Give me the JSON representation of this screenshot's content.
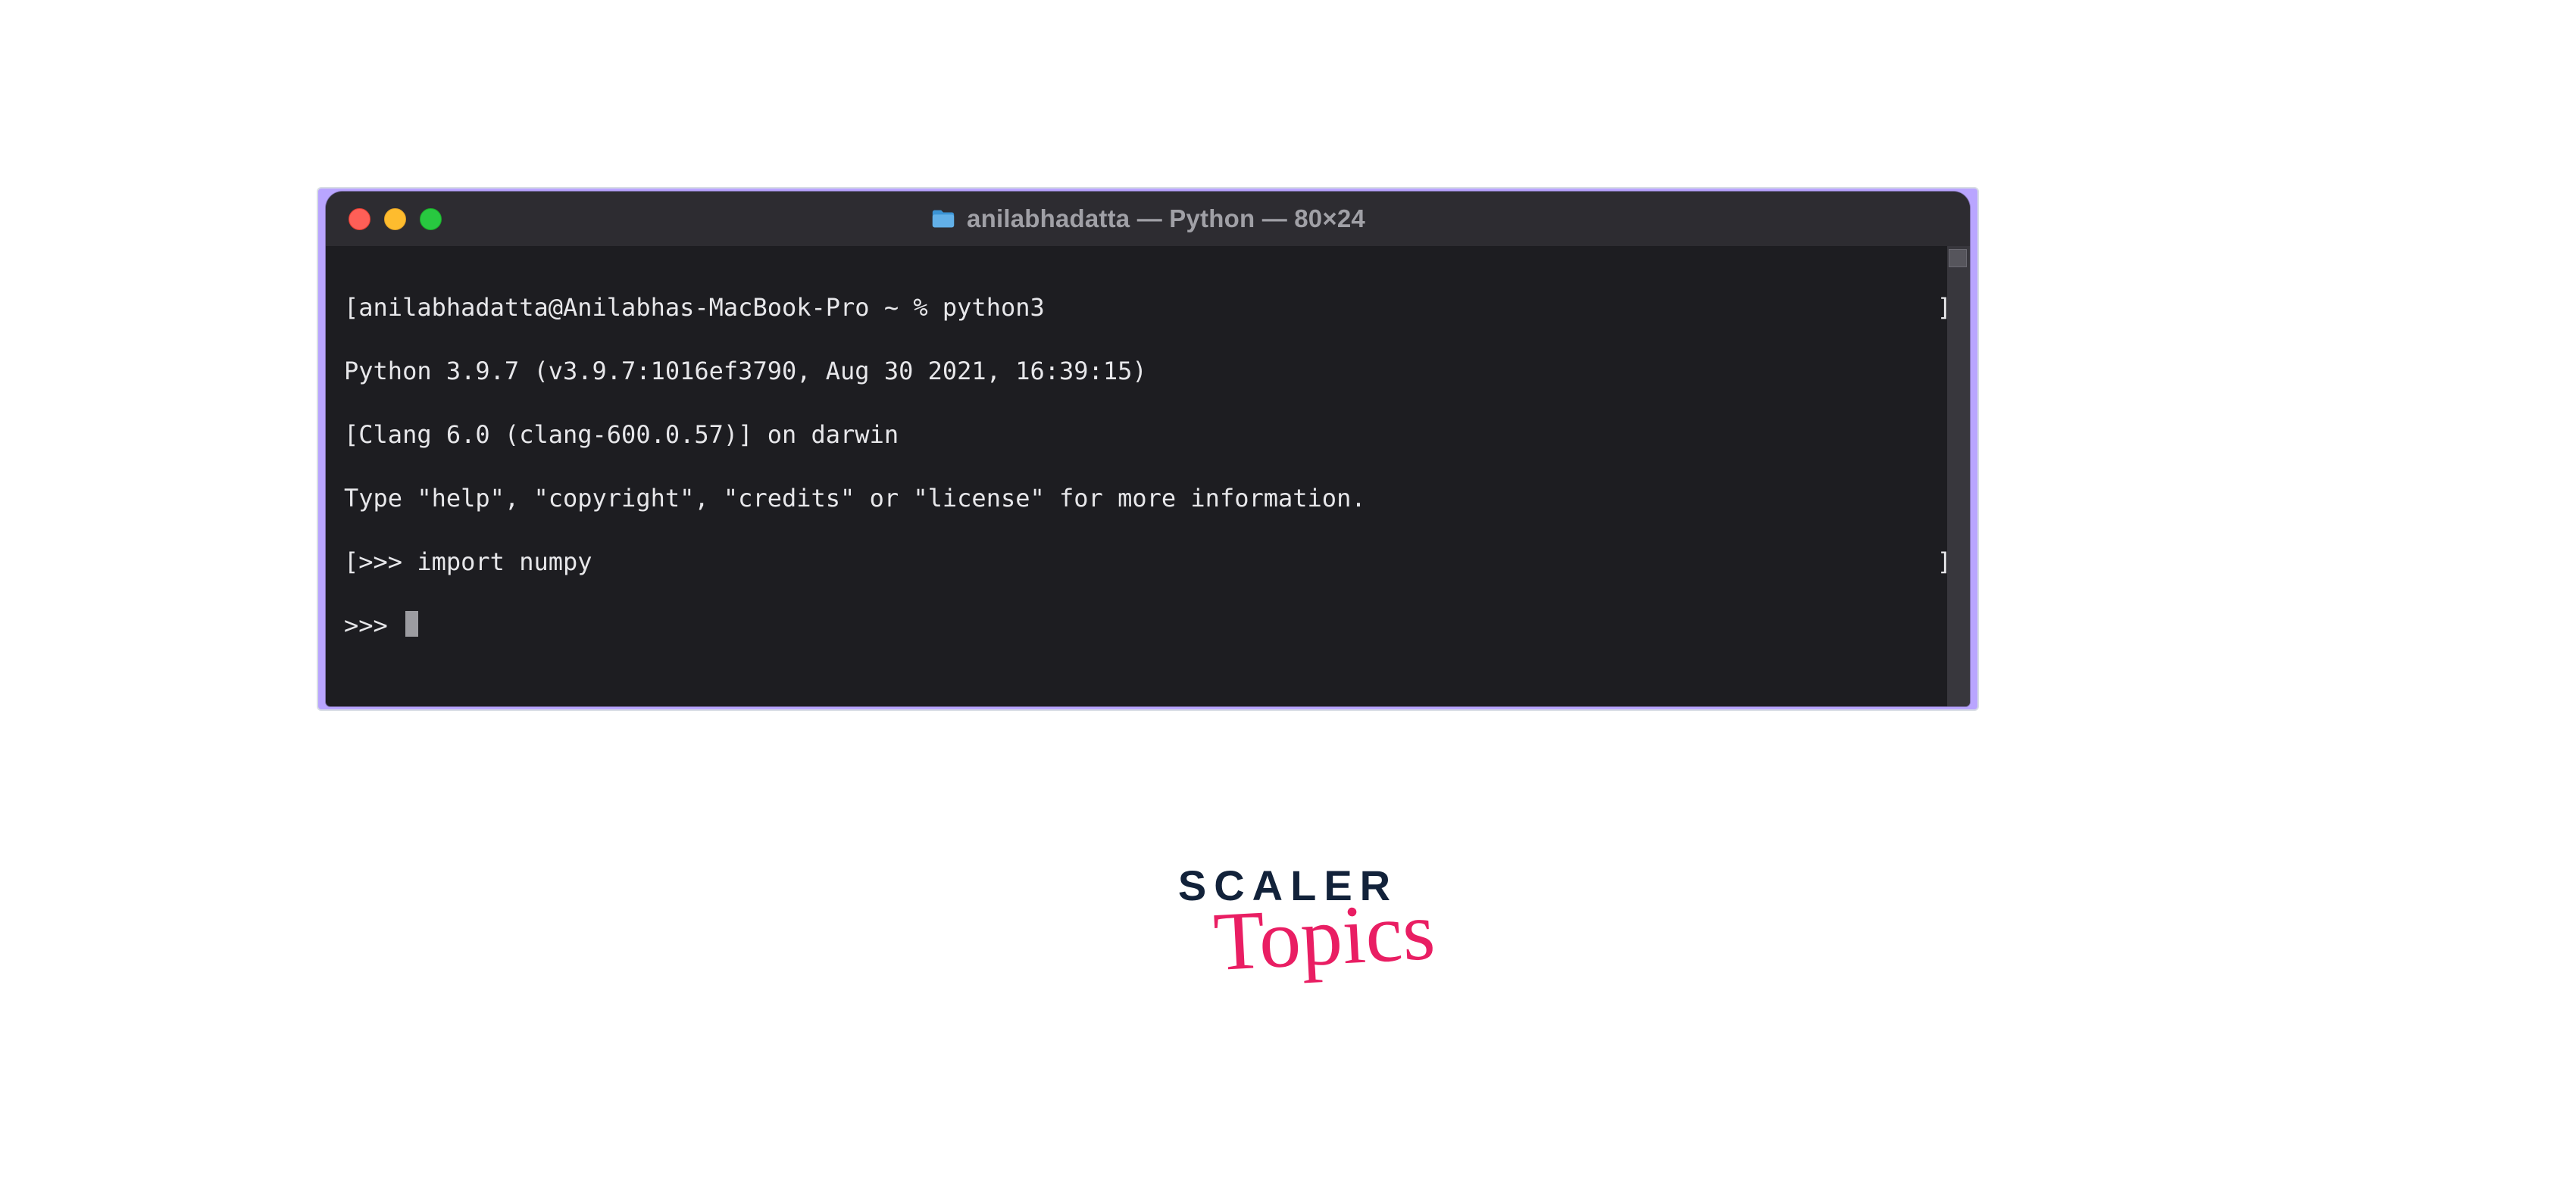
{
  "window": {
    "title": "anilabhadatta — Python — 80×24",
    "icon": "folder-icon"
  },
  "terminal": {
    "lines": {
      "l0_left": "[anilabhadatta@Anilabhas-MacBook-Pro ~ % python3",
      "l0_right": "]",
      "l1": "Python 3.9.7 (v3.9.7:1016ef3790, Aug 30 2021, 16:39:15)",
      "l2": "[Clang 6.0 (clang-600.0.57)] on darwin",
      "l3": "Type \"help\", \"copyright\", \"credits\" or \"license\" for more information.",
      "l4_left": "[>>> import numpy",
      "l4_right": "]",
      "l5_prompt": ">>> "
    }
  },
  "branding": {
    "top": "SCALER",
    "bottom": "Topics"
  }
}
